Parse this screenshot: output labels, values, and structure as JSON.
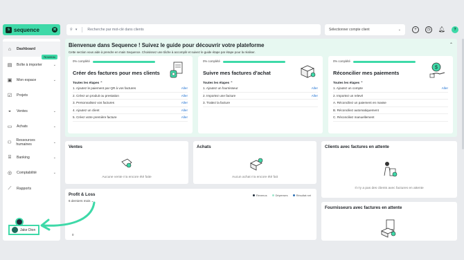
{
  "app": {
    "logo_text": "sequence",
    "brand_color": "#3ed9a8"
  },
  "topbar": {
    "search_placeholder": "Recherche par mot-clé dans clients",
    "company_select": "Sélectionner compte client",
    "icons": [
      "plus-circle-icon",
      "clock-icon",
      "bell-icon",
      "avatar"
    ],
    "avatar_initial": "?"
  },
  "sidebar": {
    "items": [
      {
        "label": "Dashboard",
        "icon": "home-icon",
        "active": true
      },
      {
        "label": "Boîte à importer",
        "icon": "inbox-icon",
        "badge": "Nouveau",
        "chevron": true
      },
      {
        "label": "Mon espace",
        "icon": "briefcase-icon",
        "chevron": true
      },
      {
        "label": "Projets",
        "icon": "check-square-icon"
      },
      {
        "label": "Ventes",
        "icon": "bag-icon",
        "chevron": true
      },
      {
        "label": "Achats",
        "icon": "cart-icon",
        "chevron": true
      },
      {
        "label": "Ressources humaines",
        "icon": "people-icon",
        "chevron": true
      },
      {
        "label": "Banking",
        "icon": "bank-icon",
        "chevron": true
      },
      {
        "label": "Comptabilité",
        "icon": "coins-icon",
        "chevron": true
      },
      {
        "label": "Rapports",
        "icon": "chart-icon"
      }
    ],
    "footer_user": "Jake Dion"
  },
  "welcome": {
    "title": "Bienvenue dans Sequence ! Suivez le guide pour découvrir votre plateforme",
    "subtitle": "Cette section vous aide à prendre en main Sequence. Choisissez une tâche à accomplir et suivez le guide étape par étape pour la réaliser.",
    "cards": [
      {
        "progress_label": "0% complété",
        "progress": 0,
        "title": "Créer des factures pour mes clients",
        "steps_header": "Toutes les étapes",
        "steps": [
          {
            "text": "1. Ajoutez le paiement par QR à vos factures",
            "action": "Aller"
          },
          {
            "text": "2. Créez un produit ou prestation",
            "action": "Aller"
          },
          {
            "text": "3. Personnalisez vos factures",
            "action": "Aller"
          },
          {
            "text": "4. Ajoutez un client",
            "action": "Aller"
          },
          {
            "text": "5. Créez votre première facture",
            "action": "Aller"
          }
        ]
      },
      {
        "progress_label": "0% complété",
        "progress": 0,
        "title": "Suivre mes factures d'achat",
        "steps_header": "Toutes les étapes",
        "steps": [
          {
            "text": "1. Ajoutez un fournisseur",
            "action": "Aller"
          },
          {
            "text": "2. Importez une facture",
            "action": "Aller"
          },
          {
            "text": "3. Traitez la facture",
            "action": ""
          }
        ]
      },
      {
        "progress_label": "0% complété",
        "progress": 0,
        "title": "Réconcilier mes paiements",
        "steps_header": "Toutes les étapes",
        "steps": [
          {
            "text": "1. Ajoutez un compte",
            "action": "Aller"
          },
          {
            "text": "2. Importez un relevé",
            "action": ""
          },
          {
            "text": "A. Réconciliez un paiement en masse",
            "action": ""
          },
          {
            "text": "B. Réconciliez automatiquement",
            "action": ""
          },
          {
            "text": "C. Réconciliez manuellement",
            "action": ""
          }
        ]
      }
    ]
  },
  "ventes": {
    "title": "Ventes",
    "empty": "Aucune vente n'a encore été faite"
  },
  "achats": {
    "title": "Achats",
    "empty": "Aucun achat n'a encore été fait"
  },
  "clients_attente": {
    "title": "Clients avec factures en attente",
    "empty": "Il n'y a pas des clients avec factures en attente"
  },
  "fournisseurs_attente": {
    "title": "Fournisseurs avec factures en attente"
  },
  "profit_loss": {
    "title": "Profit & Loss",
    "period": "6 derniers mois",
    "legend": [
      {
        "label": "Revenus",
        "color": "#1f2d3a"
      },
      {
        "label": "Dépenses",
        "color": "#9fe6cd"
      },
      {
        "label": "Résultat net",
        "color": "#2c6fb3"
      }
    ],
    "zero_label": "0"
  }
}
